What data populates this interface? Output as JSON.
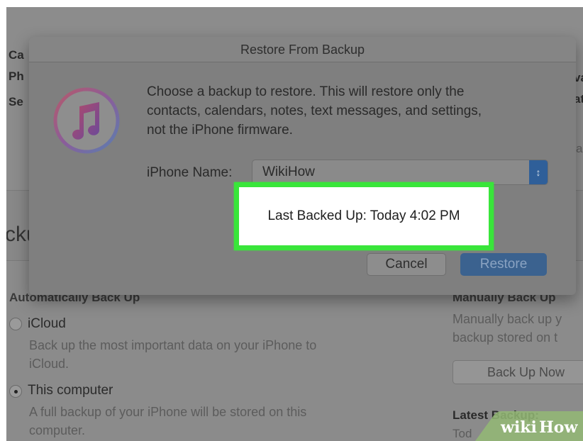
{
  "background": {
    "left_labels": [
      "Ca",
      "Ph",
      "Se"
    ],
    "right_labels": [
      "va",
      "at"
    ],
    "right_field_fragment": "a",
    "section_title_fragment": "cku",
    "auto_backup_title": "Automatically Back Up",
    "icloud_label": "iCloud",
    "icloud_desc_line1": "Back up the most important data on your iPhone to",
    "icloud_desc_line2": "iCloud.",
    "this_computer_label": "This computer",
    "computer_desc_line1": "A full backup of your iPhone will be stored on this",
    "computer_desc_line2": "computer.",
    "manual_title": "Manually Back Up",
    "manual_desc_line1": "Manually back up y",
    "manual_desc_line2": "backup stored on t",
    "back_up_now_label": "Back Up Now",
    "latest_backup_label": "Latest Backup:",
    "latest_backup_value_fragment": "Tod"
  },
  "dialog": {
    "title": "Restore From Backup",
    "message_line1": "Choose a backup to restore. This will restore only the",
    "message_line2": "contacts, calendars, notes, text messages, and settings,",
    "message_line3": "not the iPhone firmware.",
    "iphone_name_label": "iPhone Name:",
    "iphone_name_value": "WikiHow",
    "cancel_label": "Cancel",
    "restore_label": "Restore"
  },
  "highlight": {
    "text": "Last Backed Up: Today 4:02 PM"
  },
  "watermark": {
    "wiki": "wiki",
    "how": "How"
  },
  "colors": {
    "highlight_border": "#39e53a",
    "restore_button": "#3b628f",
    "watermark_green": "#93b874"
  },
  "icons": [
    "itunes-logo-icon",
    "select-stepper-icon",
    "radio-icon"
  ]
}
